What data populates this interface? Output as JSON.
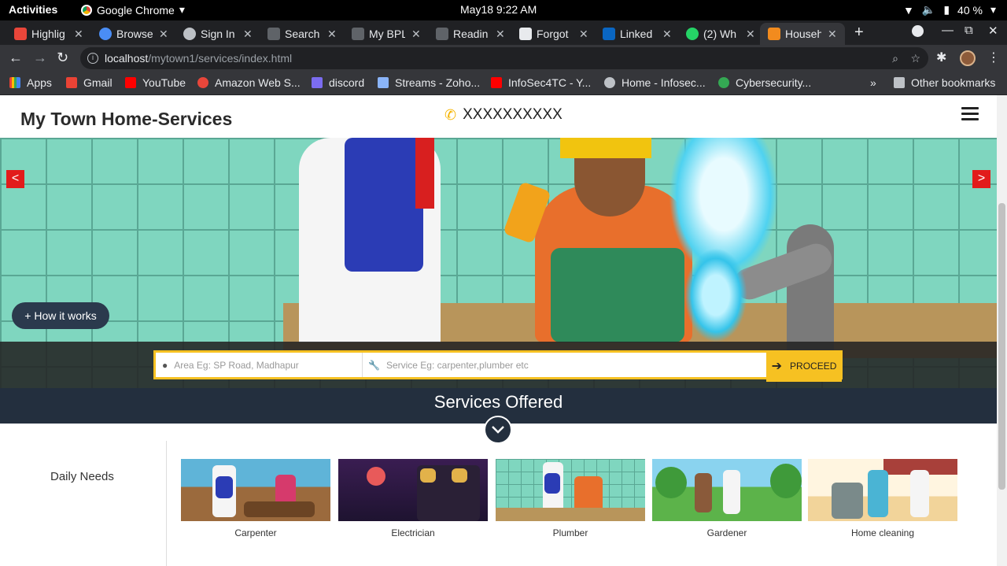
{
  "system": {
    "activities": "Activities",
    "app_name": "Google Chrome",
    "clock": "May18  9:22 AM",
    "battery": "40 %"
  },
  "tabs": [
    {
      "label": "Highlig",
      "color": "#e8463a"
    },
    {
      "label": "Browse",
      "color": "#4a8df5"
    },
    {
      "label": "Sign In",
      "color": "#bdc1c6"
    },
    {
      "label": "Search",
      "color": "#5f6368"
    },
    {
      "label": "My BPL",
      "color": "#5f6368"
    },
    {
      "label": "Readin",
      "color": "#5f6368"
    },
    {
      "label": "Forgot",
      "color": "#e8eaed"
    },
    {
      "label": "Linked",
      "color": "#0a66c2"
    },
    {
      "label": "(2) Wh",
      "color": "#25d366"
    },
    {
      "label": "Househ",
      "color": "#f28b1e",
      "active": true
    }
  ],
  "address": {
    "host": "localhost",
    "path": "/mytown1/services/index.html"
  },
  "bookmarks": [
    {
      "label": "Apps",
      "color": "#e94235"
    },
    {
      "label": "Gmail",
      "color": "#ea4335"
    },
    {
      "label": "YouTube",
      "color": "#ff0000"
    },
    {
      "label": "Amazon Web S...",
      "color": "#e8463a"
    },
    {
      "label": "discord",
      "color": "#7b6cf0"
    },
    {
      "label": "Streams - Zoho...",
      "color": "#8ab4f8"
    },
    {
      "label": "InfoSec4TC - Y...",
      "color": "#ff0000"
    },
    {
      "label": "Home - Infosec...",
      "color": "#bdc1c6"
    },
    {
      "label": "Cybersecurity...",
      "color": "#34a853"
    },
    {
      "label": "Other bookmarks",
      "color": "#bdc1c6"
    }
  ],
  "site": {
    "brand": "My Town Home-Services",
    "phone": "XXXXXXXXXX",
    "how_it_works": "+ How it works",
    "search": {
      "area_placeholder": "Area Eg: SP Road, Madhapur",
      "service_placeholder": "Service Eg: carpenter,plumber etc",
      "proceed": "PROCEED"
    },
    "services_heading": "Services Offered",
    "category": "Daily Needs",
    "services": [
      {
        "label": "Carpenter"
      },
      {
        "label": "Electrician"
      },
      {
        "label": "Plumber"
      },
      {
        "label": "Gardener"
      },
      {
        "label": "Home cleaning"
      }
    ]
  },
  "colors": {
    "accent_yellow": "#f6c122",
    "navy": "#232f3e",
    "slider_arrow": "#e21b1b"
  }
}
